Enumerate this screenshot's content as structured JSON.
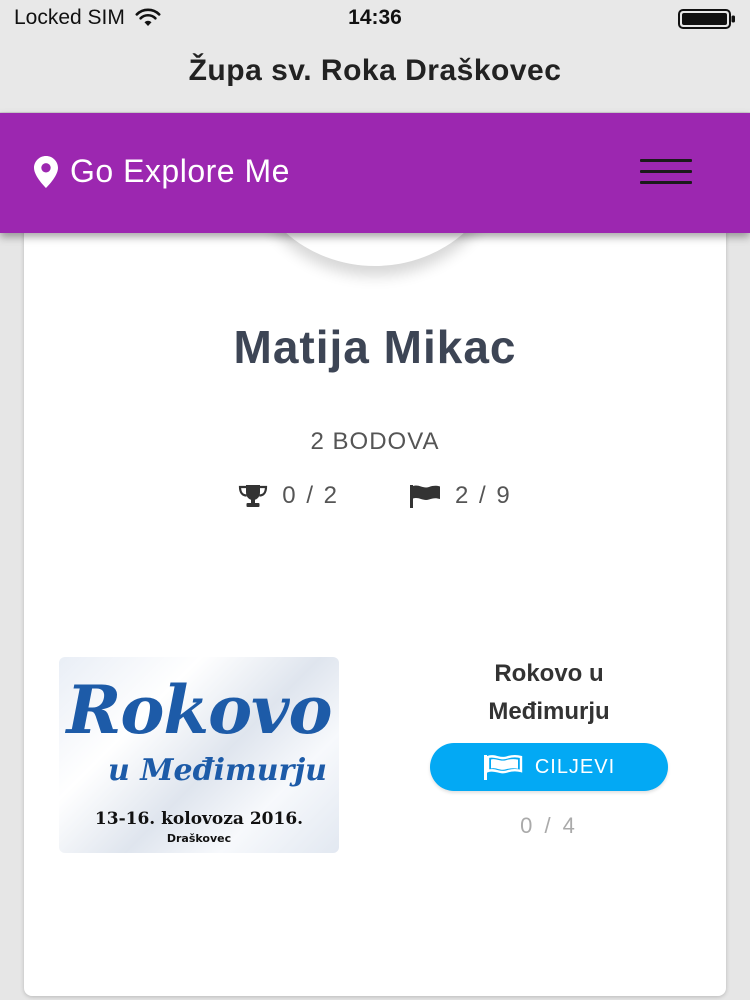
{
  "status_bar": {
    "carrier": "Locked SIM",
    "time": "14:36"
  },
  "nav": {
    "title": "Župa sv. Roka Draškovec"
  },
  "header": {
    "brand": "Go Explore Me",
    "accent_color": "#9c27b0"
  },
  "profile": {
    "name": "Matija Mikac",
    "points": "2 BODOVA",
    "trophies": "0 / 2",
    "flags": "2 / 9"
  },
  "event": {
    "poster": {
      "title": "Rokovo",
      "subtitle": "u Međimurju",
      "dates": "13-16. kolovoza 2016.",
      "place": "Draškovec"
    },
    "title_line1": "Rokovo u",
    "title_line2": "Međimurju",
    "goals_button": "CILJEVI",
    "goals_button_color": "#03a9f4",
    "goals_progress": "0 / 4"
  },
  "icons": {
    "brand": "map-marker-icon",
    "menu": "hamburger-menu-icon",
    "trophy": "trophy-icon",
    "flag": "flag-icon",
    "wifi": "wifi-icon",
    "battery": "battery-icon"
  }
}
